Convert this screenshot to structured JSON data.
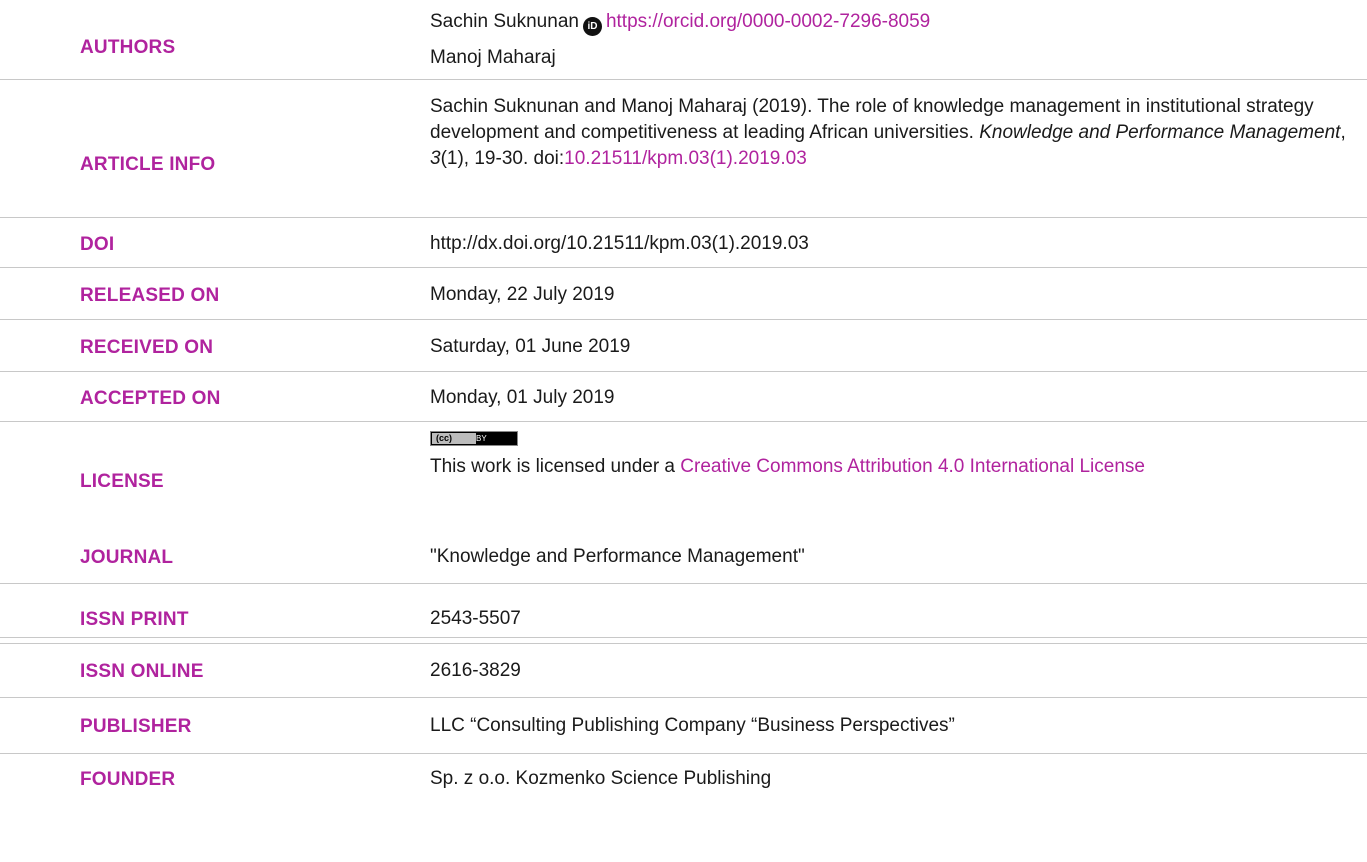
{
  "rows": {
    "authors": {
      "label": "AUTHORS",
      "author1_name": "Sachin Suknunan",
      "author1_orcid_icon": "orcid-icon",
      "author1_orcid": "https://orcid.org/0000-0002-7296-8059",
      "author2_name": "Manoj Maharaj"
    },
    "article_info": {
      "label": "ARTICLE INFO",
      "citation_prefix": "Sachin Suknunan and Manoj Maharaj (2019). The role of knowledge management in institutional strategy development and competitiveness at leading African universities. ",
      "journal_italic": "Knowledge and Performance Management",
      "sep1": ", ",
      "volume_italic": "3",
      "issue_pages": "(1), 19-30. doi:",
      "doi_link": "10.21511/kpm.03(1).2019.03"
    },
    "doi": {
      "label": "DOI",
      "value": "http://dx.doi.org/10.21511/kpm.03(1).2019.03"
    },
    "released_on": {
      "label": "RELEASED ON",
      "value": "Monday, 22 July 2019"
    },
    "received_on": {
      "label": "RECEIVED ON",
      "value": "Saturday, 01 June 2019"
    },
    "accepted_on": {
      "label": "ACCEPTED ON",
      "value": "Monday, 01 July 2019"
    },
    "license": {
      "label": "LICENSE",
      "badge_left": "(cc)",
      "badge_right": "BY",
      "text_prefix": "This work is licensed under a ",
      "link": "Creative Commons Attribution 4.0 International License"
    },
    "journal": {
      "label": "JOURNAL",
      "value": "\"Knowledge and Performance Management\""
    },
    "issn_print": {
      "label": "ISSN PRINT",
      "value": "2543-5507"
    },
    "issn_online": {
      "label": "ISSN ONLINE",
      "value": "2616-3829"
    },
    "publisher": {
      "label": "PUBLISHER",
      "value": "LLC “Consulting Publishing Company “Business Perspectives”"
    },
    "founder": {
      "label": "FOUNDER",
      "value": "Sp. z o.o. Kozmenko Science Publishing"
    }
  },
  "colors": {
    "accent": "#b0239e",
    "text": "#1a1a1a",
    "divider": "#c8c8c8"
  }
}
